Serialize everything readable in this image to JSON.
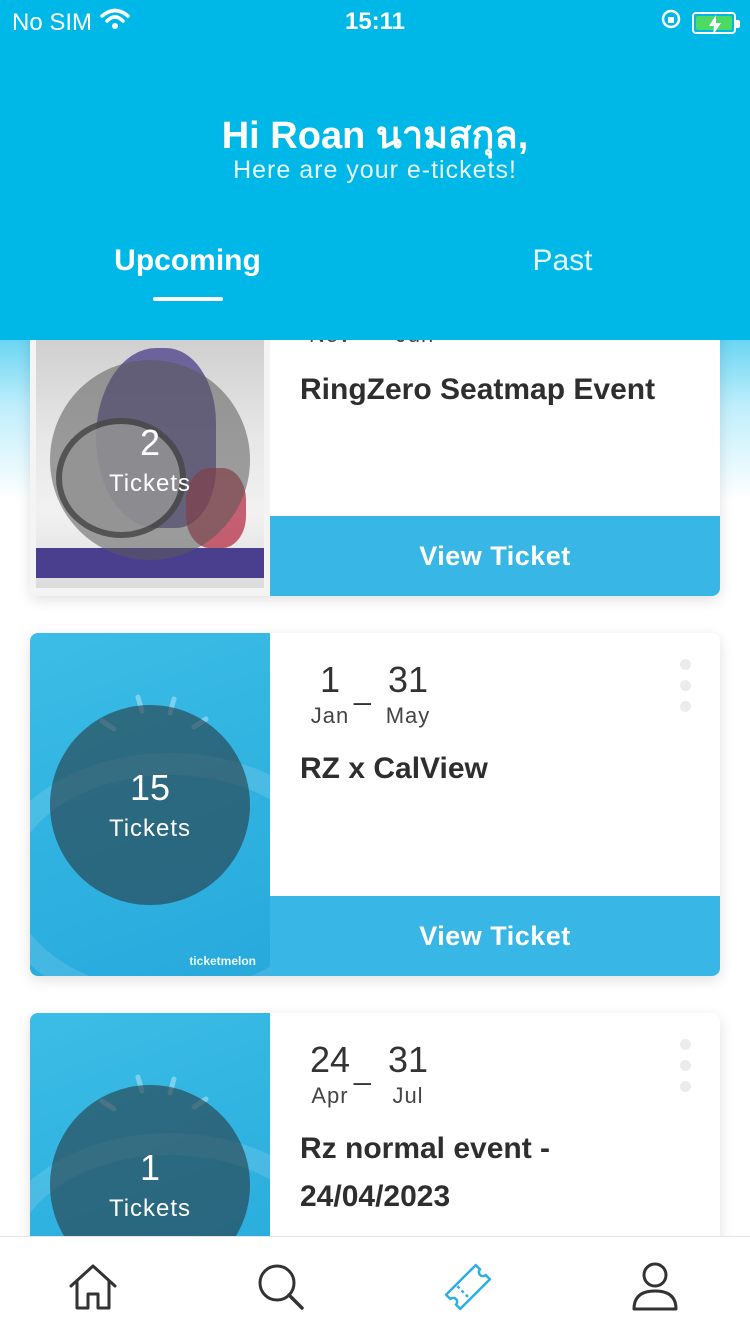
{
  "status_bar": {
    "carrier": "No SIM",
    "time": "15:11"
  },
  "header": {
    "greeting": "Hi Roan นามสกุล,",
    "subtitle": "Here are your e-tickets!",
    "tabs": [
      {
        "label": "Upcoming",
        "active": true
      },
      {
        "label": "Past",
        "active": false
      }
    ]
  },
  "colors": {
    "header_bg": "#00b8e8",
    "button_bg": "#38b6e6",
    "active_nav_icon": "#2ab0e4",
    "inactive_nav_icon": "#333333"
  },
  "tickets": [
    {
      "count": "2",
      "count_label": "Tickets",
      "start_day": "",
      "start_month": "Nov",
      "end_day": "",
      "end_month": "Jun",
      "title": "RingZero Seatmap Event",
      "button": "View Ticket"
    },
    {
      "count": "15",
      "count_label": "Tickets",
      "start_day": "1",
      "start_month": "Jan",
      "end_day": "31",
      "end_month": "May",
      "title": "RZ x CalView",
      "button": "View Ticket",
      "brand": "ticketmelon"
    },
    {
      "count": "1",
      "count_label": "Tickets",
      "start_day": "24",
      "start_month": "Apr",
      "end_day": "31",
      "end_month": "Jul",
      "title_line1": "Rz normal event -",
      "title_line2": "24/04/2023"
    }
  ],
  "date_separator": "_",
  "bottom_nav": [
    {
      "icon": "home-icon",
      "active": false
    },
    {
      "icon": "search-icon",
      "active": false
    },
    {
      "icon": "ticket-icon",
      "active": true
    },
    {
      "icon": "profile-icon",
      "active": false
    }
  ]
}
